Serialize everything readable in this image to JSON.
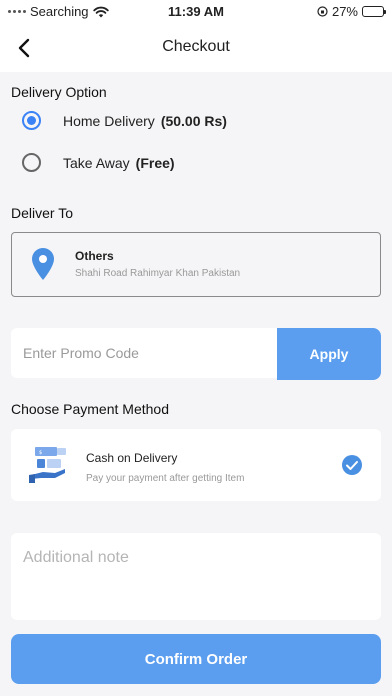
{
  "status_bar": {
    "carrier": "Searching",
    "time": "11:39 AM",
    "battery": "27%",
    "battery_level": 0.27,
    "icons": [
      "signal-dots-icon",
      "wifi-icon",
      "orientation-lock-icon",
      "battery-icon"
    ]
  },
  "header": {
    "title": "Checkout",
    "back_icon": "chevron-left-icon"
  },
  "delivery_option": {
    "title": "Delivery Option",
    "options": [
      {
        "label": "Home Delivery",
        "price": "(50.00 Rs)",
        "selected": true
      },
      {
        "label": "Take Away",
        "price": "(Free)",
        "selected": false
      }
    ]
  },
  "deliver_to": {
    "title": "Deliver To",
    "address": {
      "type": "Others",
      "line": "Shahi Road Rahimyar Khan  Pakistan",
      "icon": "location-pin-icon"
    }
  },
  "promo": {
    "placeholder": "Enter Promo Code",
    "apply_label": "Apply"
  },
  "payment": {
    "title": "Choose Payment Method",
    "method": {
      "name": "Cash on Delivery",
      "description": "Pay your payment after getting Item",
      "icon": "cash-on-delivery-icon",
      "selected": true
    }
  },
  "note": {
    "placeholder": "Additional note"
  },
  "confirm": {
    "label": "Confirm Order"
  },
  "colors": {
    "accent": "#5b9ef0",
    "radio_selected": "#3b82f6",
    "background": "#f5f5f7"
  }
}
